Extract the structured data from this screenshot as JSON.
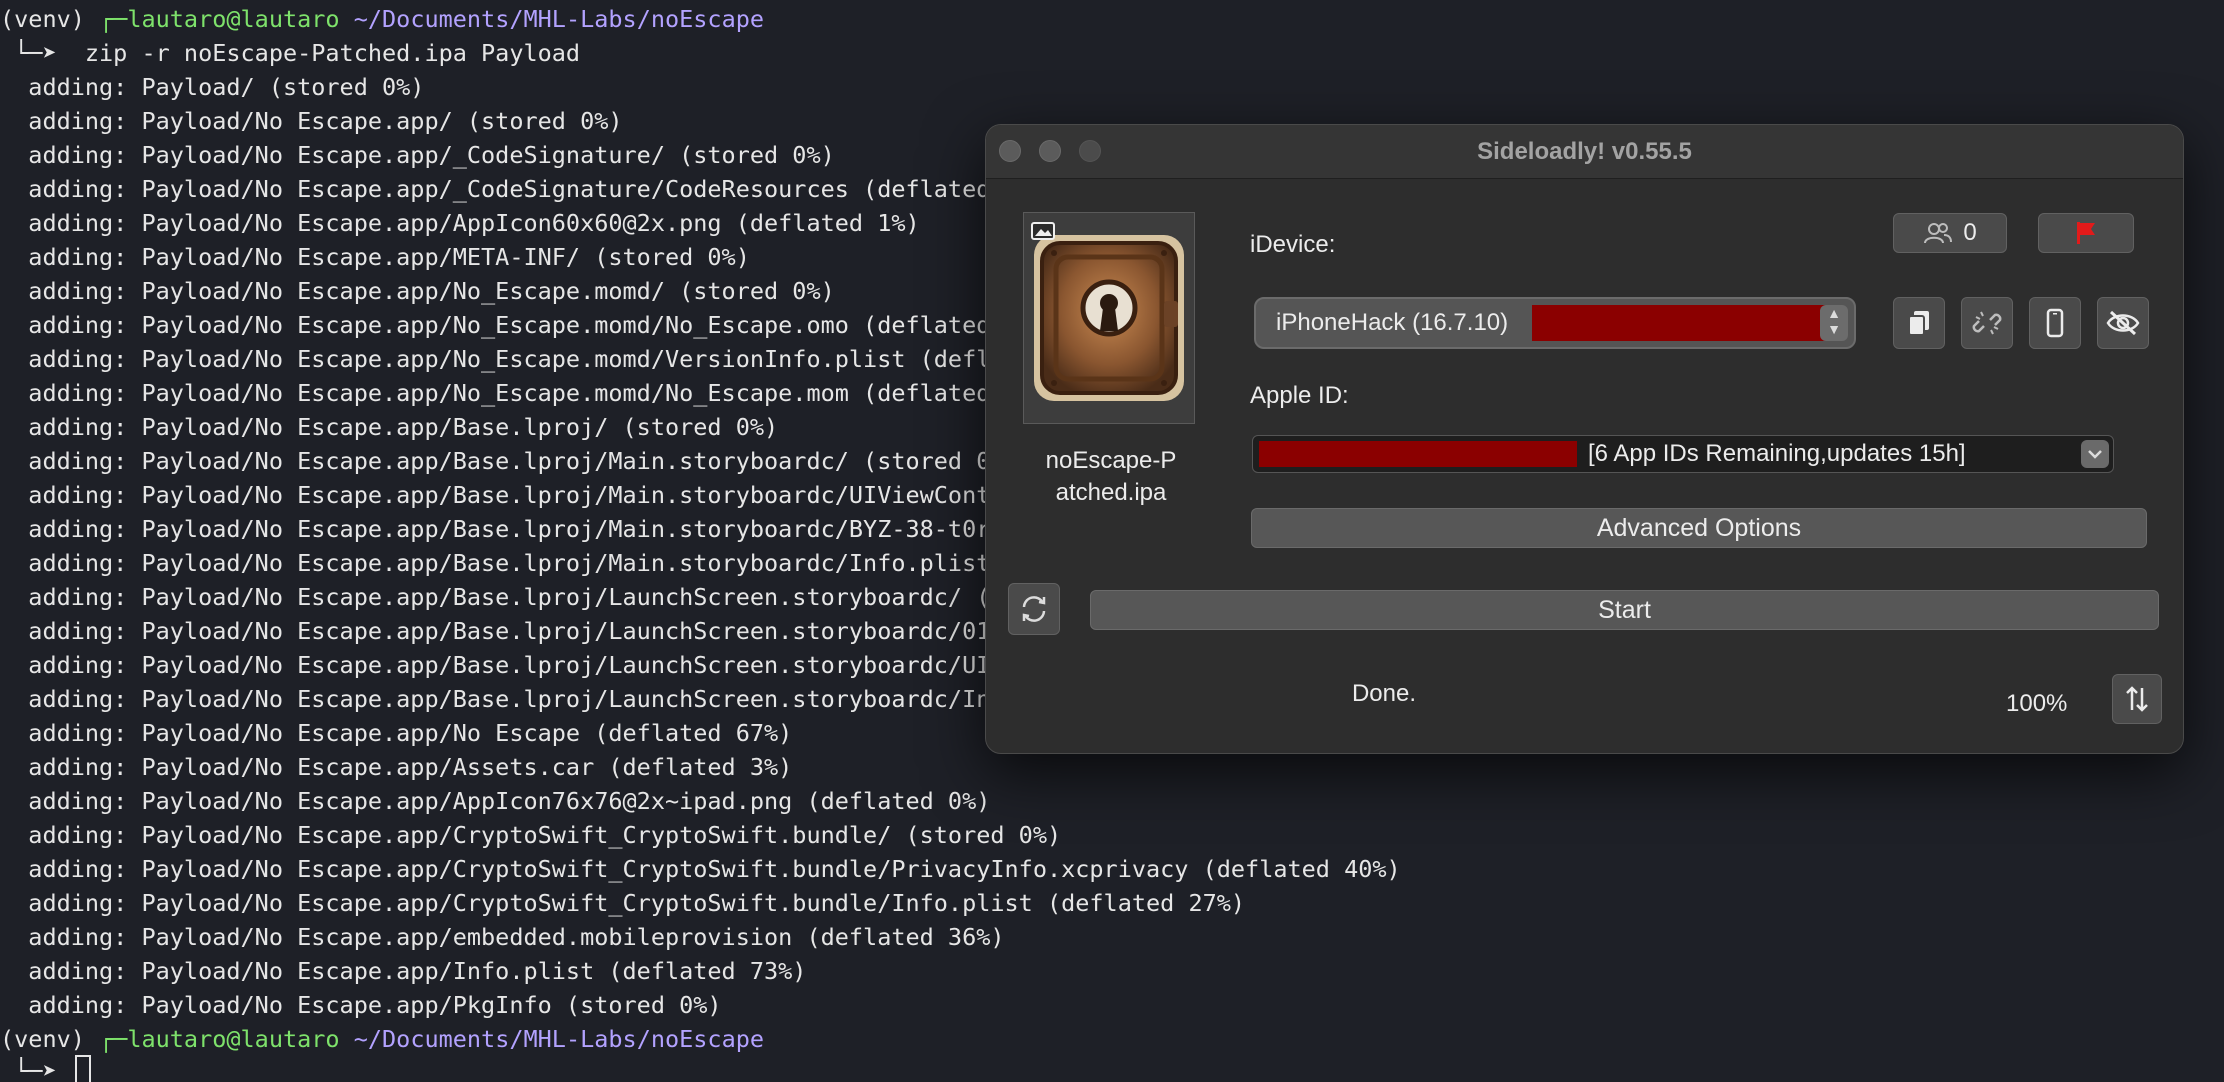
{
  "terminal": {
    "prompt1": {
      "venv": "(venv)",
      "corner": " ┌─",
      "user_host": "lautaro@lautaro",
      "path": " ~/Documents/MHL-Labs/noEscape"
    },
    "command": " └─➤  zip -r noEscape-Patched.ipa Payload",
    "output": [
      "  adding: Payload/ (stored 0%)",
      "  adding: Payload/No Escape.app/ (stored 0%)",
      "  adding: Payload/No Escape.app/_CodeSignature/ (stored 0%)",
      "  adding: Payload/No Escape.app/_CodeSignature/CodeResources (deflated",
      "  adding: Payload/No Escape.app/AppIcon60x60@2x.png (deflated 1%)",
      "  adding: Payload/No Escape.app/META-INF/ (stored 0%)",
      "  adding: Payload/No Escape.app/No_Escape.momd/ (stored 0%)",
      "  adding: Payload/No Escape.app/No_Escape.momd/No_Escape.omo (deflated",
      "  adding: Payload/No Escape.app/No_Escape.momd/VersionInfo.plist (defl",
      "  adding: Payload/No Escape.app/No_Escape.momd/No_Escape.mom (deflated",
      "  adding: Payload/No Escape.app/Base.lproj/ (stored 0%)",
      "  adding: Payload/No Escape.app/Base.lproj/Main.storyboardc/ (stored 0",
      "  adding: Payload/No Escape.app/Base.lproj/Main.storyboardc/UIViewCont",
      "  adding: Payload/No Escape.app/Base.lproj/Main.storyboardc/BYZ-38-t0r",
      "  adding: Payload/No Escape.app/Base.lproj/Main.storyboardc/Info.plist",
      "  adding: Payload/No Escape.app/Base.lproj/LaunchScreen.storyboardc/ (",
      "  adding: Payload/No Escape.app/Base.lproj/LaunchScreen.storyboardc/01",
      "  adding: Payload/No Escape.app/Base.lproj/LaunchScreen.storyboardc/UI",
      "  adding: Payload/No Escape.app/Base.lproj/LaunchScreen.storyboardc/In",
      "  adding: Payload/No Escape.app/No Escape (deflated 67%)",
      "  adding: Payload/No Escape.app/Assets.car (deflated 3%)",
      "  adding: Payload/No Escape.app/AppIcon76x76@2x~ipad.png (deflated 0%)",
      "  adding: Payload/No Escape.app/CryptoSwift_CryptoSwift.bundle/ (stored 0%)",
      "  adding: Payload/No Escape.app/CryptoSwift_CryptoSwift.bundle/PrivacyInfo.xcprivacy (deflated 40%)",
      "  adding: Payload/No Escape.app/CryptoSwift_CryptoSwift.bundle/Info.plist (deflated 27%)",
      "  adding: Payload/No Escape.app/embedded.mobileprovision (deflated 36%)",
      "  adding: Payload/No Escape.app/Info.plist (deflated 73%)",
      "  adding: Payload/No Escape.app/PkgInfo (stored 0%)"
    ],
    "prompt2": {
      "venv": "(venv)",
      "corner": " ┌─",
      "user_host": "lautaro@lautaro",
      "path": " ~/Documents/MHL-Labs/noEscape"
    },
    "command2": " └─➤ "
  },
  "window": {
    "title": "Sideloadly! v0.55.5",
    "ipa_file_name": "noEscape-P\natched.ipa",
    "idevice_label": "iDevice:",
    "device_count": "0",
    "device_value": "iPhoneHack (16.7.10)",
    "apple_id_label": "Apple ID:",
    "apple_id_suffix": "[6 App IDs Remaining,updates 15h]",
    "advanced_label": "Advanced Options",
    "start_label": "Start",
    "status": "Done.",
    "progress": "100%",
    "colors": {
      "redaction": "#8b0000",
      "flag": "#e21a1a"
    },
    "icons": [
      "users-icon",
      "flag-icon",
      "copy-icon",
      "unlink-icon",
      "phone-icon",
      "eye-off-icon",
      "refresh-icon",
      "sort-arrows-icon",
      "chevron-down-icon",
      "stepper-icon"
    ]
  }
}
